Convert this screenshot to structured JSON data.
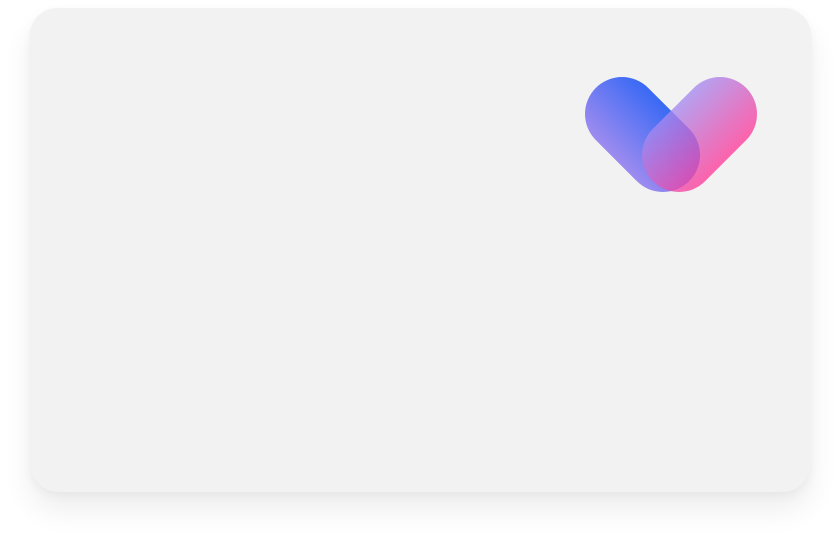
{
  "card": {
    "background": "#f2f2f2"
  },
  "logo": {
    "icon": "heart-logo-icon",
    "left_pill_gradient": [
      "#2f62f5",
      "#8f7ff0"
    ],
    "right_pill_gradient": [
      "#ff3d9a",
      "#9b86f0"
    ]
  }
}
